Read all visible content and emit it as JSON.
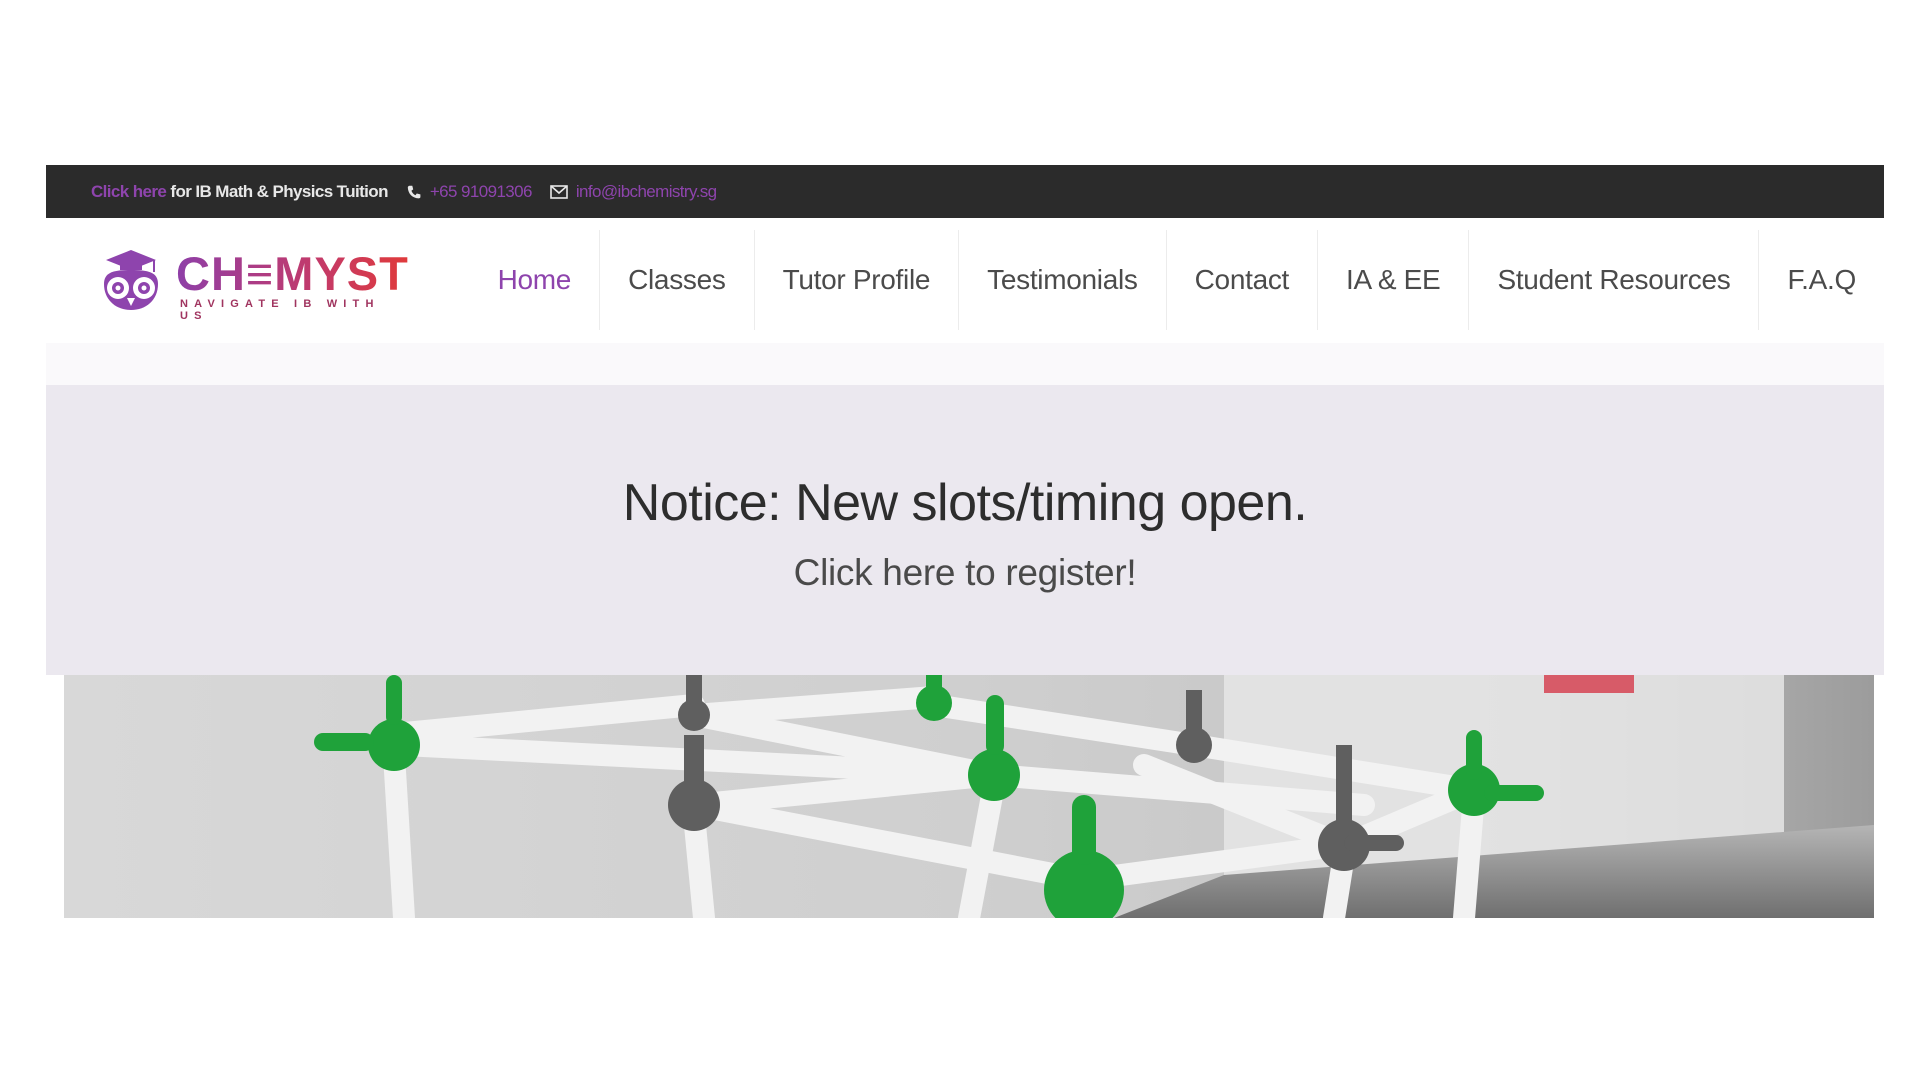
{
  "topbar": {
    "promo_link": "Click here",
    "promo_text": " for IB Math & Physics Tuition",
    "phone": "+65 91091306",
    "email": "info@ibchemistry.sg",
    "background": "#2b2b2b",
    "accent": "#8e44ad"
  },
  "header": {
    "logo_wordmark": "CH≡MYST",
    "logo_tagline": "NAVIGATE IB WITH US",
    "logo_icon": "owl-graduation-cap-icon"
  },
  "nav": {
    "items": [
      {
        "label": "Home",
        "active": true
      },
      {
        "label": "Classes",
        "active": false
      },
      {
        "label": "Tutor Profile",
        "active": false
      },
      {
        "label": "Testimonials",
        "active": false
      },
      {
        "label": "Contact",
        "active": false
      },
      {
        "label": "IA & EE",
        "active": false
      },
      {
        "label": "Student Resources",
        "active": false
      },
      {
        "label": "F.A.Q",
        "active": false
      }
    ],
    "active_color": "#8e44ad"
  },
  "notice": {
    "title": "Notice: New slots/timing open.",
    "register_link": "Click here to register!",
    "background": "#ebe8ef"
  },
  "hero": {
    "image_subject": "molecular-model-photo"
  }
}
